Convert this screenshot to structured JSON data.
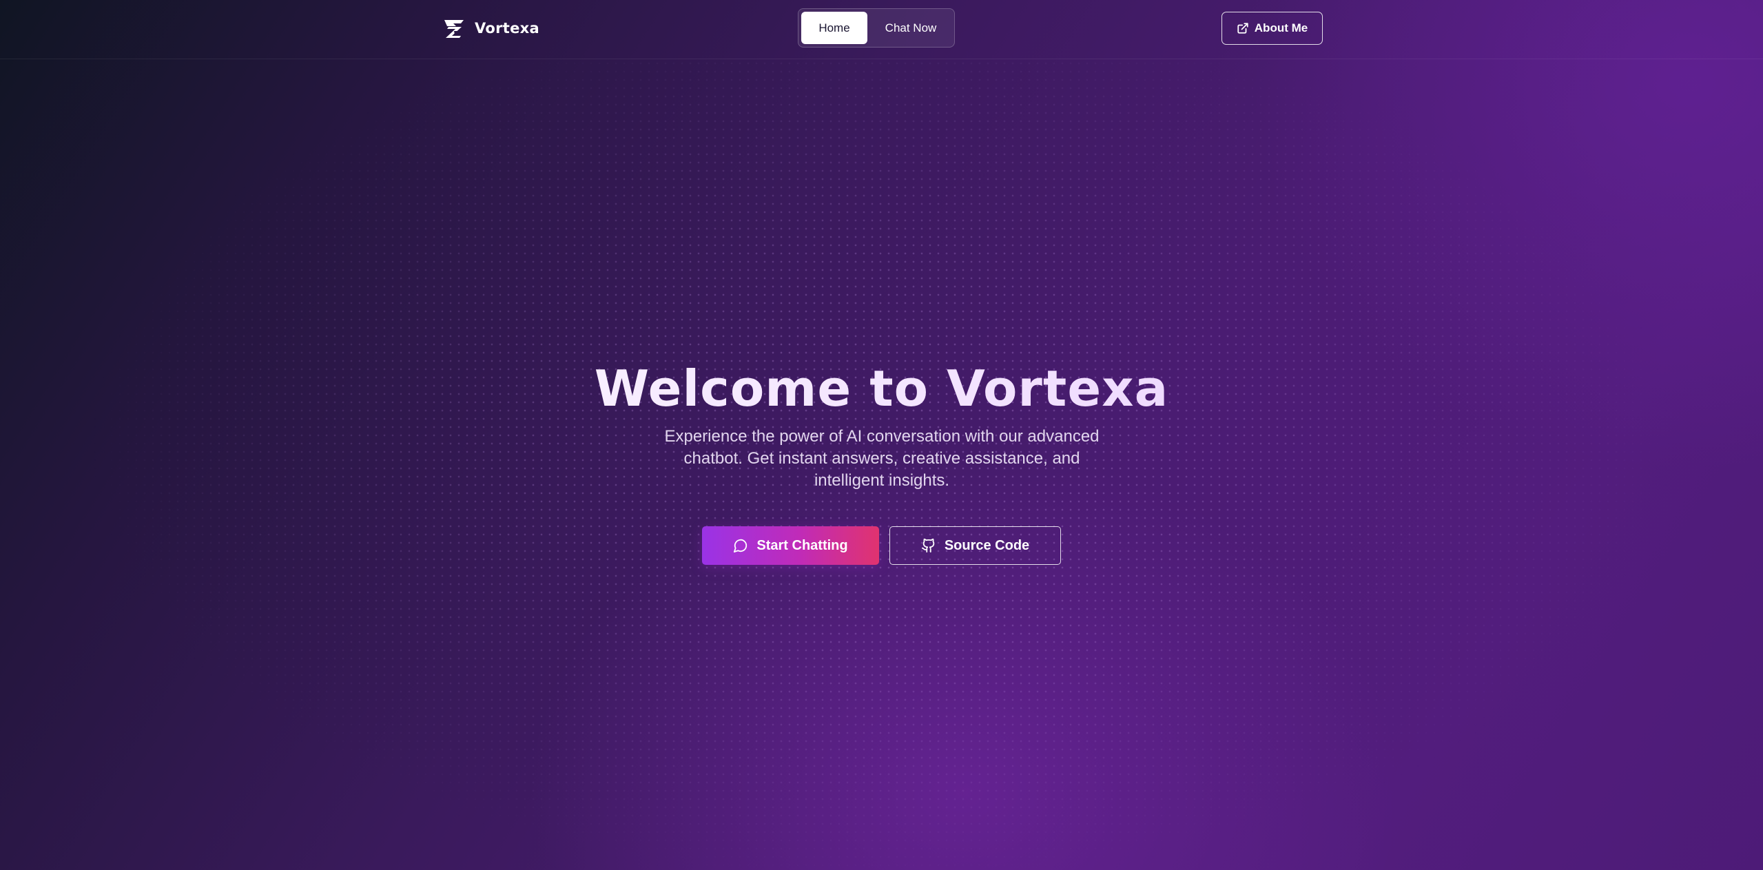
{
  "header": {
    "brand_name": "Vortexa",
    "logo_icon": "vortexa-logo-icon",
    "nav_tabs": [
      {
        "label": "Home",
        "active": true
      },
      {
        "label": "Chat Now",
        "active": false
      }
    ],
    "about_button": {
      "label": "About Me",
      "icon": "external-link-icon"
    }
  },
  "hero": {
    "title": "Welcome to Vortexa",
    "subtitle": "Experience the power of AI conversation with our advanced chatbot. Get instant answers, creative assistance, and intelligent insights.",
    "primary_button": {
      "label": "Start Chatting",
      "icon": "message-circle-icon"
    },
    "secondary_button": {
      "label": "Source Code",
      "icon": "github-icon"
    }
  },
  "colors": {
    "background_dark": "#101523",
    "background_purple": "#521d7d",
    "accent_gradient_start": "#9a33e6",
    "accent_gradient_end": "#e0336f",
    "active_tab_bg": "#ffffff"
  }
}
